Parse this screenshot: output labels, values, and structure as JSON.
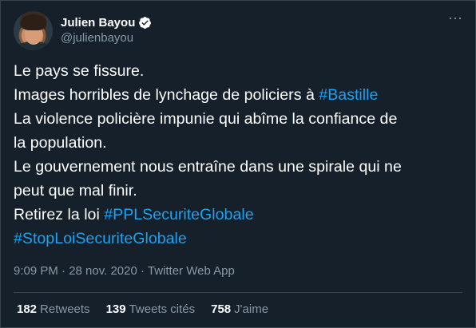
{
  "author": {
    "display_name": "Julien Bayou",
    "handle": "@julienbayou",
    "verified": true
  },
  "more_icon": "···",
  "tweet": {
    "lines": [
      [
        {
          "text": "Le pays se fissure.",
          "hashtag": false
        }
      ],
      [
        {
          "text": "Images horribles de lynchage de policiers à ",
          "hashtag": false
        },
        {
          "text": "#Bastille",
          "hashtag": true
        }
      ],
      [
        {
          "text": "La violence policière impunie qui abîme la confiance de",
          "hashtag": false
        }
      ],
      [
        {
          "text": "la population.",
          "hashtag": false
        }
      ],
      [
        {
          "text": "Le gouvernement nous entraîne dans une spirale qui ne",
          "hashtag": false
        }
      ],
      [
        {
          "text": "peut que mal finir.",
          "hashtag": false
        }
      ],
      [
        {
          "text": "Retirez la loi ",
          "hashtag": false
        },
        {
          "text": "#PPLSecuriteGlobale",
          "hashtag": true
        }
      ],
      [
        {
          "text": "#StopLoiSecuriteGlobale",
          "hashtag": true
        }
      ]
    ]
  },
  "meta": {
    "time": "9:09 PM · 28 nov. 2020 · Twitter Web App"
  },
  "stats": {
    "retweets_count": "182",
    "retweets_label": "Retweets",
    "quotes_count": "139",
    "quotes_label": "Tweets cités",
    "likes_count": "758",
    "likes_label": "J'aime"
  },
  "colors": {
    "background": "#15202b",
    "hashtag": "#1da1f2",
    "secondary_text": "#8899a6",
    "divider": "#38444d"
  }
}
